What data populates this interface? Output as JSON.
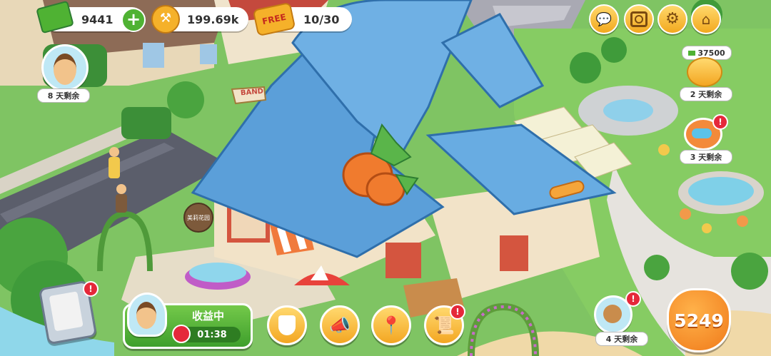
{
  "resources": {
    "cash": "9441",
    "coins": "199.69k",
    "free_label": "FREE",
    "free_progress": "10/30"
  },
  "events": {
    "top_left_timer": "8 天剩余",
    "piggy_amount": "37500",
    "piggy_timer": "2 天剩余",
    "diving_timer": "3 天剩余",
    "squirrel_timer": "4 天剩余"
  },
  "shop": {
    "sign_text": "BAND",
    "garden_sign": "美莉花园"
  },
  "earnings": {
    "label": "收益中",
    "timer": "01:38"
  },
  "score": "5249",
  "badges": {
    "alert": "!"
  },
  "colors": {
    "roof": "#5b9fd9",
    "grass": "#7fc463",
    "gold": "#f5b12a",
    "green_button": "#4fb233",
    "badge_red": "#e5283a"
  },
  "icons": [
    "cash-icon",
    "add-icon",
    "hammer-coin-icon",
    "free-ticket-icon",
    "chat-icon",
    "camera-icon",
    "gear-icon",
    "home-icon",
    "piggy-bank-icon",
    "diving-mask-icon",
    "clipboard-icon",
    "shield-icon",
    "megaphone-icon",
    "map-pin-icon",
    "scroll-icon",
    "stopwatch-icon"
  ]
}
